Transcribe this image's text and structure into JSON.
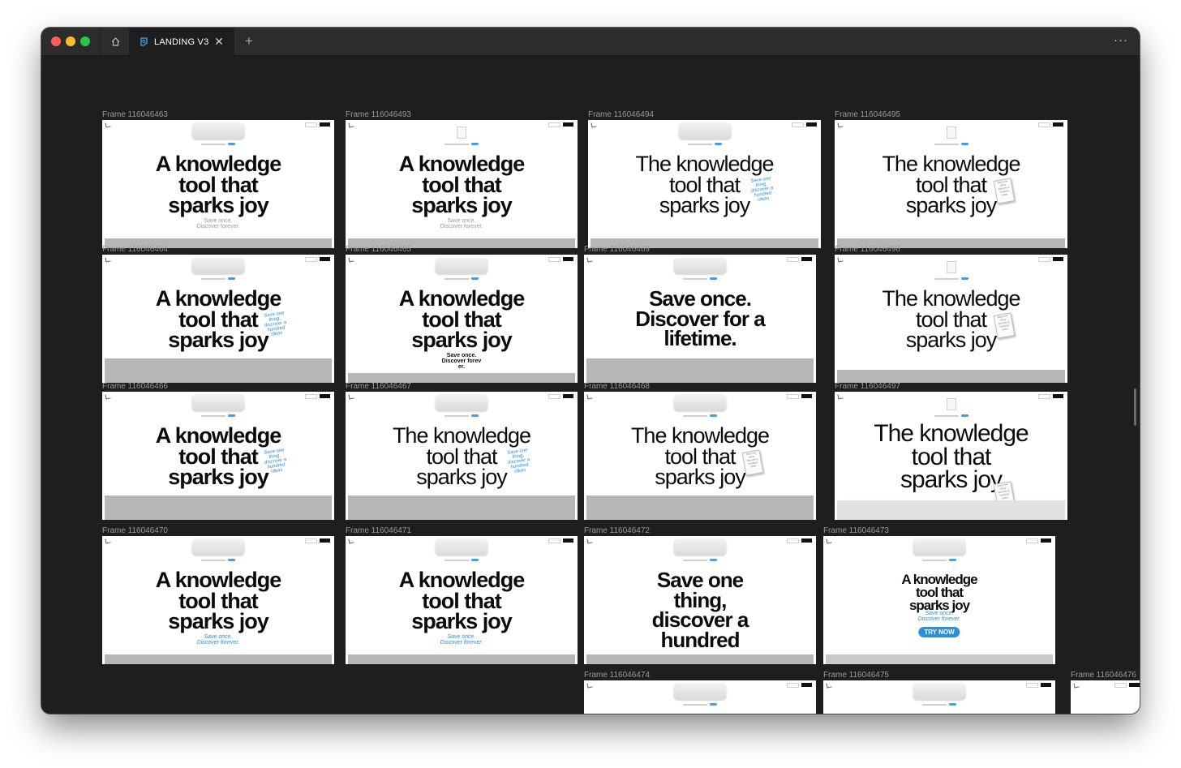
{
  "window": {
    "tab_title": "LANDING V3",
    "traffic_lights": {
      "close": "#ff5f57",
      "minimize": "#febc2e",
      "zoom": "#28c840"
    },
    "icons": {
      "home": "home-icon",
      "tab": "file-icon",
      "close": "close-icon",
      "new_tab": "plus-icon",
      "more": "more-icon"
    }
  },
  "labels": {
    "close_x": "✕",
    "plus": "+",
    "more": "···"
  },
  "frames": [
    {
      "label": "Frame 116046463",
      "headline": [
        "A knowledge",
        "tool that",
        "sparks joy"
      ],
      "sub": [
        "Save once.",
        "Discover forever."
      ],
      "style": "bold"
    },
    {
      "label": "Frame 116046493",
      "headline": [
        "A knowledge",
        "tool that",
        "sparks joy"
      ],
      "sub": [
        "Save once.",
        "Discover forever."
      ],
      "style": "bold"
    },
    {
      "label": "Frame 116046494",
      "headline": [
        "The knowledge",
        "tool that",
        "sparks joy"
      ],
      "note": [
        "Save one",
        "thing,",
        "discover a",
        "hundred",
        "ideas"
      ],
      "style": "light"
    },
    {
      "label": "Frame 116046495",
      "headline": [
        "The knowledge",
        "tool that",
        "sparks joy"
      ],
      "card": [
        "Save one",
        "thing,",
        "discover a",
        "hundred",
        "other"
      ],
      "style": "light"
    },
    {
      "label": "Frame 116046464",
      "headline": [
        "A knowledge",
        "tool that",
        "sparks joy"
      ],
      "note": [
        "Save one",
        "thing,",
        "discover a",
        "hundred",
        "ideas"
      ],
      "style": "bold"
    },
    {
      "label": "Frame 116046465",
      "headline": [
        "A knowledge",
        "tool that",
        "sparks joy"
      ],
      "sub": [
        "Save once.",
        "Discover forev",
        "er."
      ],
      "style": "bold"
    },
    {
      "label": "Frame 116046469",
      "headline": [
        "Save once.",
        "Discover for a",
        "lifetime."
      ],
      "style": "bold"
    },
    {
      "label": "Frame 116046496",
      "headline": [
        "The knowledge",
        "tool that",
        "sparks joy"
      ],
      "card": [
        "Save one",
        "thing,",
        "discover a",
        "hundred",
        "other"
      ],
      "style": "light"
    },
    {
      "label": "Frame 116046466",
      "headline": [
        "A knowledge",
        "tool that",
        "sparks joy"
      ],
      "note": [
        "Save one",
        "thing,",
        "discover a",
        "hundred",
        "ideas"
      ],
      "style": "bold"
    },
    {
      "label": "Frame 116046467",
      "headline": [
        "The knowledge",
        "tool that",
        "sparks joy"
      ],
      "note": [
        "Save one",
        "thing,",
        "discover a",
        "hundred",
        "ideas"
      ],
      "style": "light"
    },
    {
      "label": "Frame 116046468",
      "headline": [
        "The knowledge",
        "tool that",
        "sparks joy"
      ],
      "card": [
        "Save one",
        "thing,",
        "discover a",
        "hundred",
        "other"
      ],
      "style": "light"
    },
    {
      "label": "Frame 116046497",
      "headline": [
        "The knowledge",
        "tool that",
        "sparks joy"
      ],
      "card": [
        "Save one",
        "thing,",
        "discover a",
        "hundred",
        "other"
      ],
      "style": "light"
    },
    {
      "label": "Frame 116046470",
      "headline": [
        "A knowledge",
        "tool that",
        "sparks joy"
      ],
      "sub": [
        "Save once.",
        "Discover forever."
      ],
      "style": "bold"
    },
    {
      "label": "Frame 116046471",
      "headline": [
        "A knowledge",
        "tool that",
        "sparks joy"
      ],
      "sub": [
        "Save once.",
        "Discover forever."
      ],
      "style": "bold"
    },
    {
      "label": "Frame 116046472",
      "headline": [
        "Save one",
        "thing,",
        "discover a",
        "hundred"
      ],
      "style": "bold"
    },
    {
      "label": "Frame 116046473",
      "headline": [
        "A knowledge",
        "tool that",
        "sparks joy"
      ],
      "sub": [
        "Save once.",
        "Discover forever."
      ],
      "cta": "TRY NOW",
      "style": "bold"
    },
    {
      "label": "Frame 116046474",
      "headline": [],
      "style": "bold"
    },
    {
      "label": "Frame 116046475",
      "headline": [],
      "style": "bold"
    },
    {
      "label": "Frame 116046476",
      "headline": [],
      "style": "bold"
    }
  ]
}
